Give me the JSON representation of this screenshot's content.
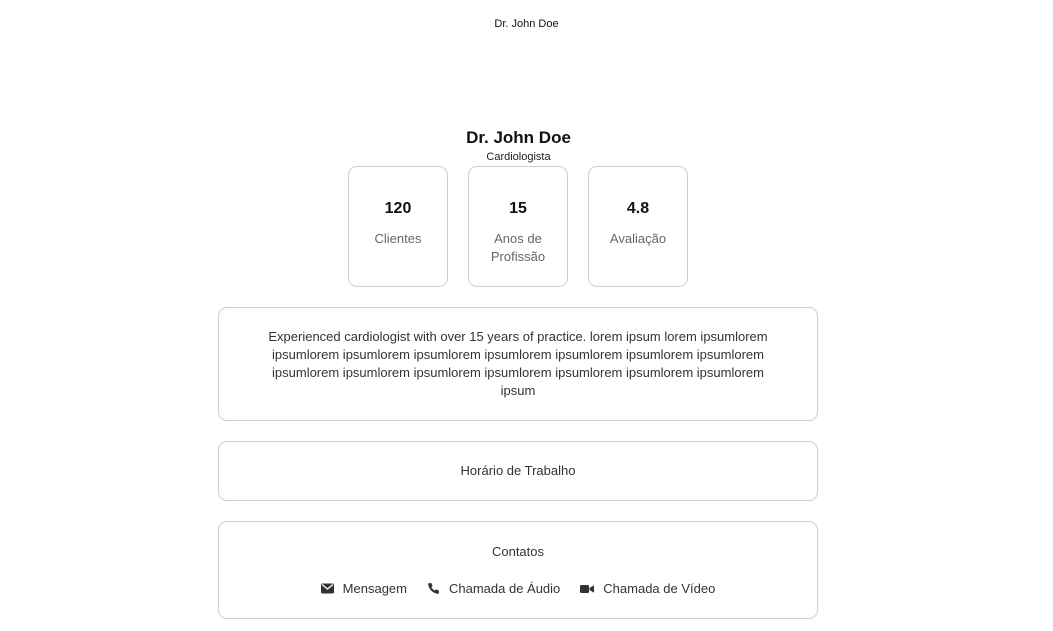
{
  "header": {
    "title": "Dr. John Doe"
  },
  "profile": {
    "name": "Dr. John Doe",
    "specialty": "Cardiologista"
  },
  "stats": [
    {
      "value": "120",
      "label": "Clientes"
    },
    {
      "value": "15",
      "label": "Anos de Profissão"
    },
    {
      "value": "4.8",
      "label": "Avaliação"
    }
  ],
  "bio": {
    "text": "Experienced cardiologist with over 15 years of practice. lorem ipsum lorem ipsumlorem ipsumlorem ipsumlorem ipsumlorem ipsumlorem ipsumlorem ipsumlorem ipsumlorem ipsumlorem ipsumlorem ipsumlorem ipsumlorem ipsumlorem ipsumlorem ipsumlorem ipsum"
  },
  "hours": {
    "label": "Horário de Trabalho"
  },
  "contacts": {
    "title": "Contatos",
    "actions": [
      {
        "icon": "envelope-icon",
        "label": "Mensagem"
      },
      {
        "icon": "phone-icon",
        "label": "Chamada de Áudio"
      },
      {
        "icon": "video-camera-icon",
        "label": "Chamada de Vídeo"
      }
    ]
  },
  "colors": {
    "border": "#cfcfcf",
    "text": "#333333",
    "muted": "#666666"
  }
}
